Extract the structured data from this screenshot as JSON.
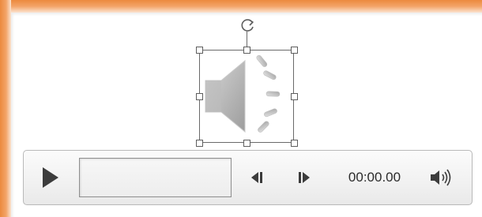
{
  "media_controls": {
    "play_icon": "play-triangle-icon",
    "progress": 0,
    "back_icon": "step-back-icon",
    "forward_icon": "step-forward-icon",
    "time": "00:00.00",
    "volume_icon": "speaker-volume-icon"
  },
  "audio_object": {
    "icon": "speaker-icon",
    "selected": true
  },
  "colors": {
    "slide_border": "#ec8a3e",
    "control_bar": "#f2f2f2",
    "icon_dark": "#3c3c3c",
    "speaker_gray": "#b5b5b5"
  }
}
